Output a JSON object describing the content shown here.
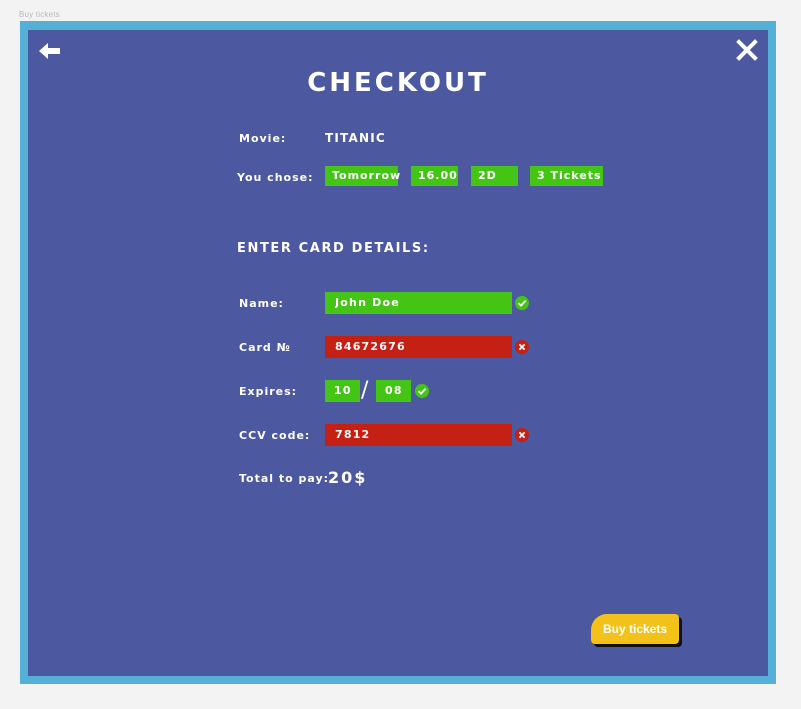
{
  "canvas": {
    "frame_label": "Buy tickets"
  },
  "header": {
    "title": "CHECKOUT",
    "back_icon": "arrow-left-icon",
    "close_icon": "close-icon"
  },
  "summary": {
    "movie_label": "Movie:",
    "movie_value": "TITANIC",
    "chose_label": "You chose:",
    "chips": [
      {
        "label": "Tomorrow"
      },
      {
        "label": "16.00"
      },
      {
        "label": "2D"
      },
      {
        "label": "3 Tickets"
      }
    ]
  },
  "card": {
    "heading": "ENTER CARD DETAILS:",
    "name": {
      "label": "Name:",
      "value": "John Doe",
      "status": "valid"
    },
    "number": {
      "label": "Card №",
      "value": "84672676",
      "status": "invalid"
    },
    "expires": {
      "label": "Expires:",
      "month": "10",
      "separator": "/",
      "year": "08",
      "status": "valid"
    },
    "ccv": {
      "label": "CCV code:",
      "value": "7812",
      "status": "invalid"
    }
  },
  "total": {
    "label": "Total to pay:",
    "value": "20$"
  },
  "actions": {
    "buy_label": "Buy tickets"
  },
  "colors": {
    "frame": "#54b0d6",
    "panel": "#4c58a0",
    "valid": "#44c516",
    "invalid": "#c52014",
    "accent_button": "#f2c21a"
  }
}
